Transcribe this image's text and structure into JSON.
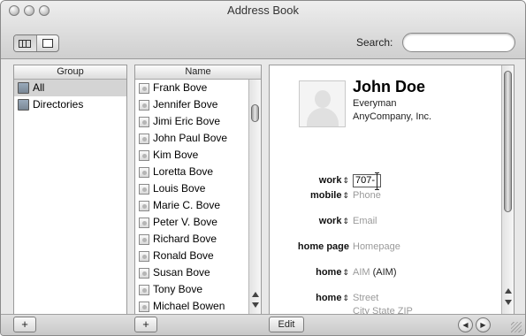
{
  "window": {
    "title": "Address Book"
  },
  "toolbar": {
    "search_label": "Search:",
    "search_value": ""
  },
  "group_column": {
    "header": "Group",
    "items": [
      {
        "label": "All",
        "selected": true
      },
      {
        "label": "Directories",
        "selected": false
      }
    ]
  },
  "name_column": {
    "header": "Name",
    "items": [
      "Frank Bove",
      "Jennifer Bove",
      "Jimi Eric Bove",
      "John Paul Bove",
      "Kim Bove",
      "Loretta Bove",
      "Louis Bove",
      "Marie C. Bove",
      "Peter V. Bove",
      "Richard Bove",
      "Ronald Bove",
      "Susan Bove",
      "Tony Bove",
      "Michael Bowen"
    ]
  },
  "card": {
    "full_name": "John Doe",
    "job_title": "Everyman",
    "company": "AnyCompany, Inc.",
    "fields": {
      "work_phone_label": "work",
      "work_phone_value": "707-",
      "mobile_label": "mobile",
      "mobile_placeholder": "Phone",
      "email_label": "work",
      "email_placeholder": "Email",
      "homepage_label": "home page",
      "homepage_placeholder": "Homepage",
      "aim_label": "home",
      "aim_placeholder": "AIM",
      "aim_suffix": "(AIM)",
      "address_label": "home",
      "address_street": "Street",
      "address_city": "City State ZIP"
    }
  },
  "bottombar": {
    "add_group": "+",
    "add_person": "+",
    "edit": "Edit",
    "prev": "◀",
    "next": "▶"
  }
}
